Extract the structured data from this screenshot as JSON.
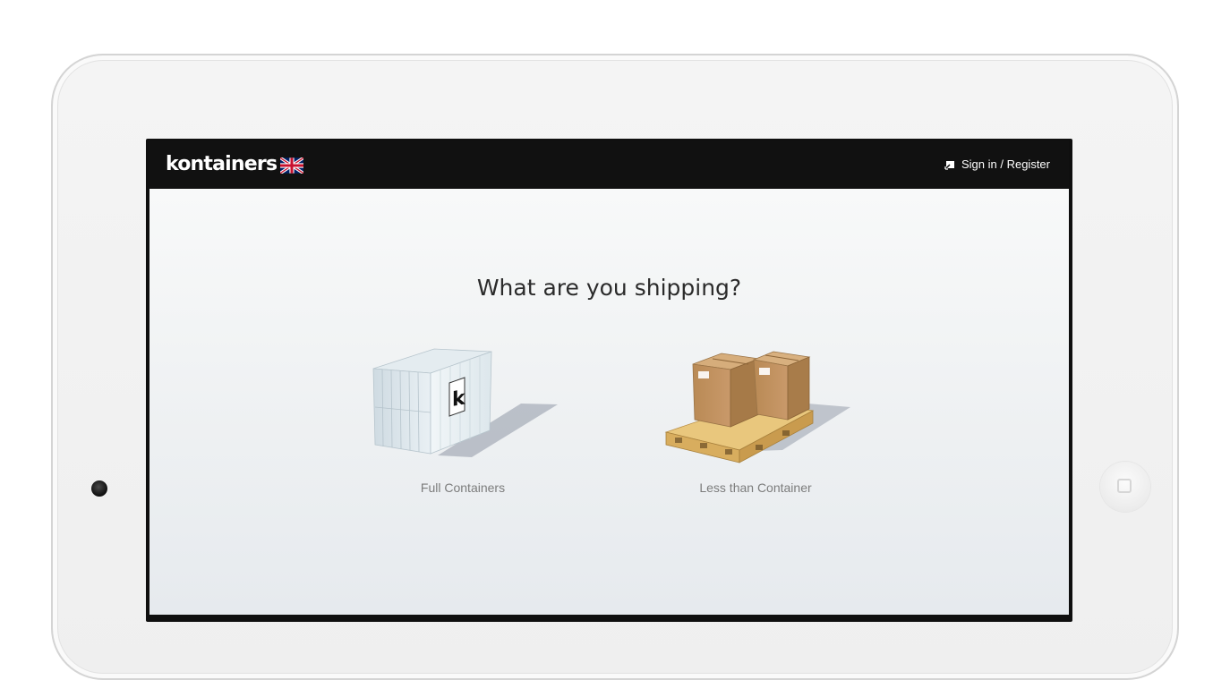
{
  "app": {
    "logo_text": "kontainers",
    "language_flag": "uk-flag-icon",
    "signin_label": "Sign in / Register"
  },
  "main": {
    "heading": "What are you shipping?",
    "options": [
      {
        "label": "Full Containers",
        "icon": "shipping-container-icon"
      },
      {
        "label": "Less than Container",
        "icon": "boxes-on-pallet-icon"
      }
    ]
  },
  "colors": {
    "topbar": "#111111",
    "heading_text": "#2b2b2b",
    "label_text": "#7c7c7c"
  }
}
